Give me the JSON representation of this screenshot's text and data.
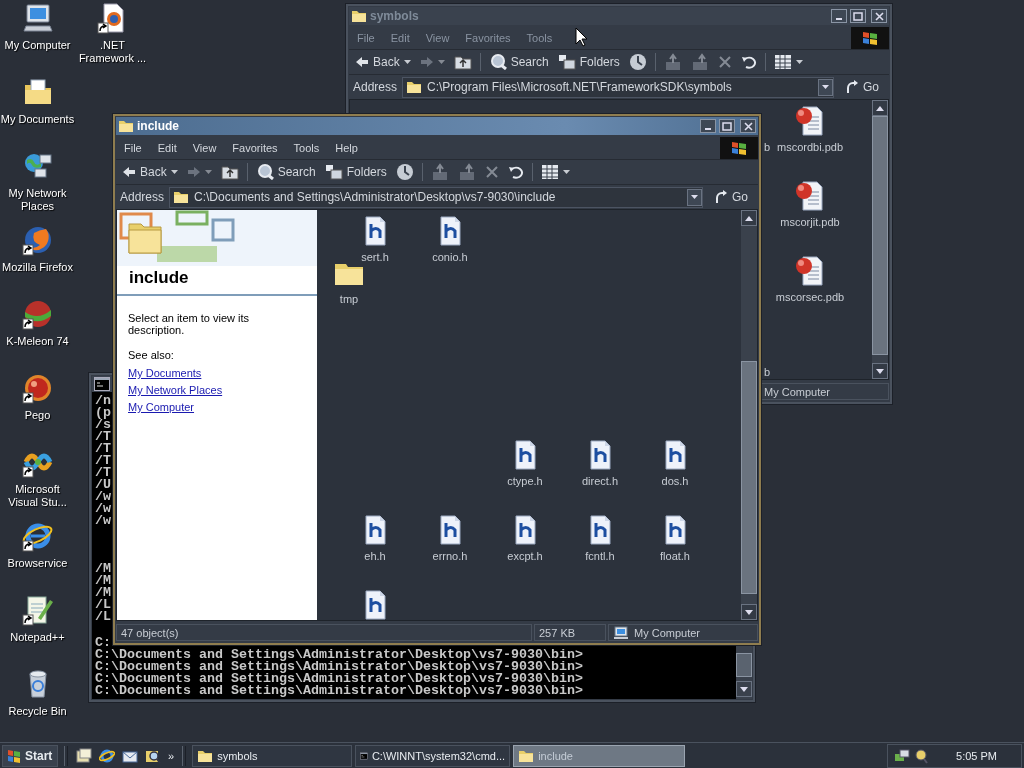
{
  "desktop": {
    "icons": [
      {
        "label": "My Computer",
        "kind": "computer",
        "shortcut": false
      },
      {
        "label": ".NET Framework ...",
        "kind": "document",
        "shortcut": true
      },
      {
        "label": "My Documents",
        "kind": "documents-folder",
        "shortcut": false
      },
      {
        "label": "My Network Places",
        "kind": "network",
        "shortcut": false
      },
      {
        "label": "Mozilla Firefox",
        "kind": "globe",
        "shortcut": true
      },
      {
        "label": "K-Meleon 74",
        "kind": "melon",
        "shortcut": true
      },
      {
        "label": "Pego",
        "kind": "ball",
        "shortcut": true
      },
      {
        "label": "Microsoft Visual Stu...",
        "kind": "ribbon",
        "shortcut": true
      },
      {
        "label": "Browservice",
        "kind": "orbit",
        "shortcut": true
      },
      {
        "label": "Notepad++",
        "kind": "notepad",
        "shortcut": true
      },
      {
        "label": "Recycle Bin",
        "kind": "recycle",
        "shortcut": false
      }
    ]
  },
  "symbols_window": {
    "title": "symbols",
    "active": false,
    "menu": [
      {
        "label": "File"
      },
      {
        "label": "Edit"
      },
      {
        "label": "View"
      },
      {
        "label": "Favorites"
      },
      {
        "label": "Tools"
      }
    ],
    "toolbar": {
      "back": "Back",
      "search": "Search",
      "folders": "Folders"
    },
    "address": {
      "label": "Address",
      "path": "C:\\Program Files\\Microsoft.NET\\FrameworkSDK\\symbols",
      "go": "Go"
    },
    "items": [
      {
        "name": "mscordbi.pdb",
        "kind": "pdb"
      },
      {
        "name": "mscorjit.pdb",
        "kind": "pdb"
      },
      {
        "name": "mscorsec.pdb",
        "kind": "pdb"
      }
    ],
    "cut_labels": [
      "b",
      "b"
    ],
    "status": {
      "zone": "My Computer"
    }
  },
  "cmd_window": {
    "lines_top": [
      "/n",
      "(p",
      "/s",
      "/T",
      "/T",
      "/T",
      "/T",
      "/U",
      "/w",
      "/w",
      "/w"
    ],
    "lines_mid": [
      "/M",
      "/M",
      "/M",
      "/L",
      "/L"
    ],
    "lines_bottom": [
      "C:",
      "C:\\Documents and Settings\\Administrator\\Desktop\\vs7-9030\\bin>",
      "C:\\Documents and Settings\\Administrator\\Desktop\\vs7-9030\\bin>",
      "C:\\Documents and Settings\\Administrator\\Desktop\\vs7-9030\\bin>",
      "C:\\Documents and Settings\\Administrator\\Desktop\\vs7-9030\\bin>"
    ]
  },
  "include_window": {
    "title": "include",
    "active": true,
    "menu": [
      {
        "label": "File"
      },
      {
        "label": "Edit"
      },
      {
        "label": "View"
      },
      {
        "label": "Favorites"
      },
      {
        "label": "Tools"
      },
      {
        "label": "Help"
      }
    ],
    "toolbar": {
      "back": "Back",
      "search": "Search",
      "folders": "Folders"
    },
    "address": {
      "label": "Address",
      "path": "C:\\Documents and Settings\\Administrator\\Desktop\\vs7-9030\\include",
      "go": "Go"
    },
    "task_pane": {
      "title": "include",
      "description": "Select an item to view its description.",
      "see_also": "See also:",
      "links": [
        "My Documents",
        "My Network Places",
        "My Computer"
      ]
    },
    "items": [
      {
        "name": "sert.h",
        "kind": "header"
      },
      {
        "name": "conio.h",
        "kind": "header"
      },
      {
        "name": "tmp",
        "kind": "folder"
      },
      {
        "name": "ctype.h",
        "kind": "header"
      },
      {
        "name": "direct.h",
        "kind": "header"
      },
      {
        "name": "dos.h",
        "kind": "header"
      },
      {
        "name": "eh.h",
        "kind": "header"
      },
      {
        "name": "errno.h",
        "kind": "header"
      },
      {
        "name": "excpt.h",
        "kind": "header"
      },
      {
        "name": "fcntl.h",
        "kind": "header"
      },
      {
        "name": "float.h",
        "kind": "header"
      },
      {
        "kind": "header"
      }
    ],
    "status": {
      "objects": "47 object(s)",
      "size": "257 KB",
      "zone": "My Computer"
    }
  },
  "taskbar": {
    "start": "Start",
    "more": "»",
    "tasks": [
      {
        "label": "symbols",
        "kind": "folder",
        "selected": false
      },
      {
        "label": "C:\\WINNT\\system32\\cmd...",
        "kind": "console",
        "selected": false
      },
      {
        "label": "include",
        "kind": "folder",
        "selected": true
      }
    ],
    "clock": "5:05 PM"
  }
}
